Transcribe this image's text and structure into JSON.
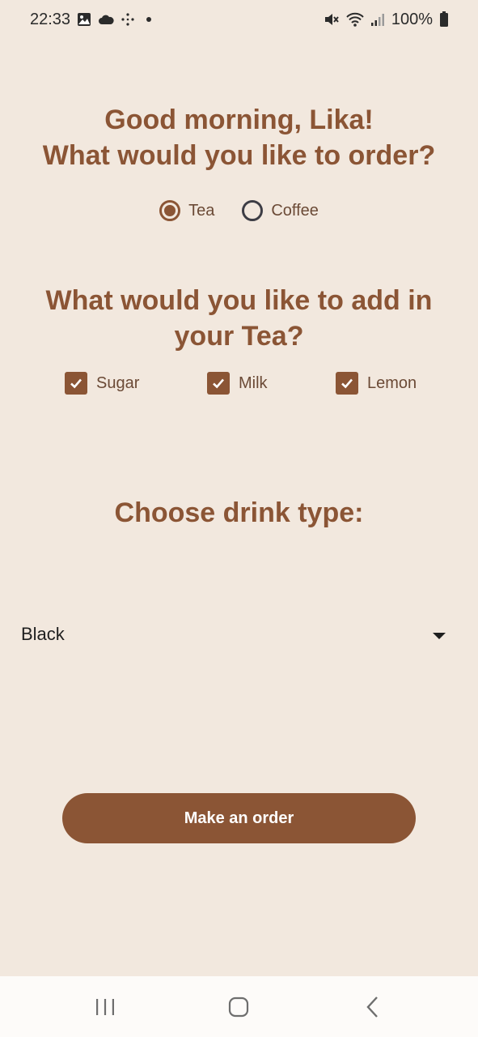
{
  "status_bar": {
    "time": "22:33",
    "battery": "100%",
    "left_icons": [
      "image-icon",
      "cloud-icon",
      "sparkle-icon",
      "dot-icon"
    ],
    "right_icons": [
      "mute-icon",
      "wifi-icon",
      "signal-icon",
      "battery-icon"
    ]
  },
  "greeting": {
    "line1": "Good morning, Lika!",
    "line2": "What would you like to order?"
  },
  "drink_choice": {
    "options": [
      {
        "label": "Tea",
        "selected": true
      },
      {
        "label": "Coffee",
        "selected": false
      }
    ]
  },
  "additions": {
    "heading_line1": "What would you like to add in",
    "heading_line2": "your Tea?",
    "options": [
      {
        "label": "Sugar",
        "checked": true
      },
      {
        "label": "Milk",
        "checked": true
      },
      {
        "label": "Lemon",
        "checked": true
      }
    ]
  },
  "drink_type": {
    "heading": "Choose drink type:",
    "selected": "Black"
  },
  "order_button": {
    "label": "Make an order"
  },
  "colors": {
    "background": "#F2E8DE",
    "accent": "#8B5535",
    "nav_bar": "#FDFBF9"
  },
  "nav_bar": {
    "icons": [
      "recent-apps-icon",
      "home-icon",
      "back-icon"
    ]
  }
}
